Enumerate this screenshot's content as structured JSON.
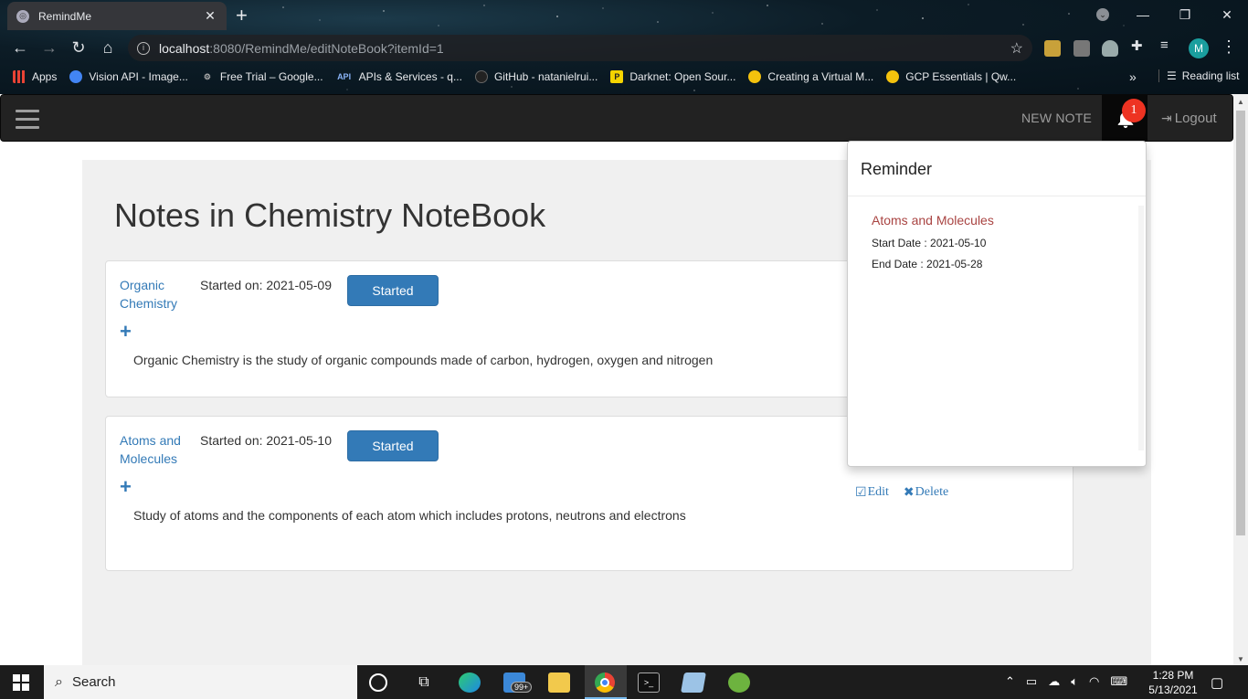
{
  "browser": {
    "tab_title": "RemindMe",
    "tab_close": "✕",
    "new_tab": "+",
    "url_host": "localhost",
    "url_path": ":8080/RemindMe/editNoteBook?itemId=1",
    "avatar_letter": "M",
    "window_controls": [
      "—",
      "❐",
      "✕"
    ],
    "bookmarks": [
      {
        "label": "Apps",
        "icon": "apps-grid-icon"
      },
      {
        "label": "Vision API - Image...",
        "icon": "google-cloud-icon"
      },
      {
        "label": "Free Trial – Google...",
        "icon": "gear-icon"
      },
      {
        "label": "APIs & Services - q...",
        "icon": "api-icon"
      },
      {
        "label": "GitHub - natanielrui...",
        "icon": "github-icon"
      },
      {
        "label": "Darknet: Open Sour...",
        "icon": "darknet-icon"
      },
      {
        "label": "Creating a Virtual M...",
        "icon": "qwiklabs-icon"
      },
      {
        "label": "GCP Essentials | Qw...",
        "icon": "qwiklabs-icon"
      }
    ],
    "bookmarks_more": "»",
    "reading_list": "Reading list"
  },
  "app": {
    "navbar": {
      "new_note": "NEW NOTE",
      "notification_count": "1",
      "logout": "Logout"
    },
    "page_title": "Notes in Chemistry NoteBook",
    "notes": [
      {
        "name": "Organic Chemistry",
        "started": "Started on: 2021-05-09",
        "status": "Started",
        "description": "Organic Chemistry is the study of organic compounds made of carbon, hydrogen, oxygen and nitrogen"
      },
      {
        "name": "Atoms and Molecules",
        "started": "Started on: 2021-05-10",
        "status": "Started",
        "description": "Study of atoms and the components of each atom which includes protons, neutrons and electrons",
        "edit": "Edit",
        "delete": "Delete"
      }
    ],
    "reminder_popover": {
      "title": "Reminder",
      "item_name": "Atoms and Molecules",
      "start_date": "Start Date : 2021-05-10",
      "end_date": "End Date : 2021-05-28"
    }
  },
  "taskbar": {
    "search_placeholder": "Search",
    "mail_badge": "99+",
    "time": "1:28 PM",
    "date": "5/13/2021"
  },
  "colors": {
    "link": "#337ab7",
    "reminder_name": "#a94442",
    "navbar_bg": "#222222",
    "badge": "#ee3322"
  }
}
